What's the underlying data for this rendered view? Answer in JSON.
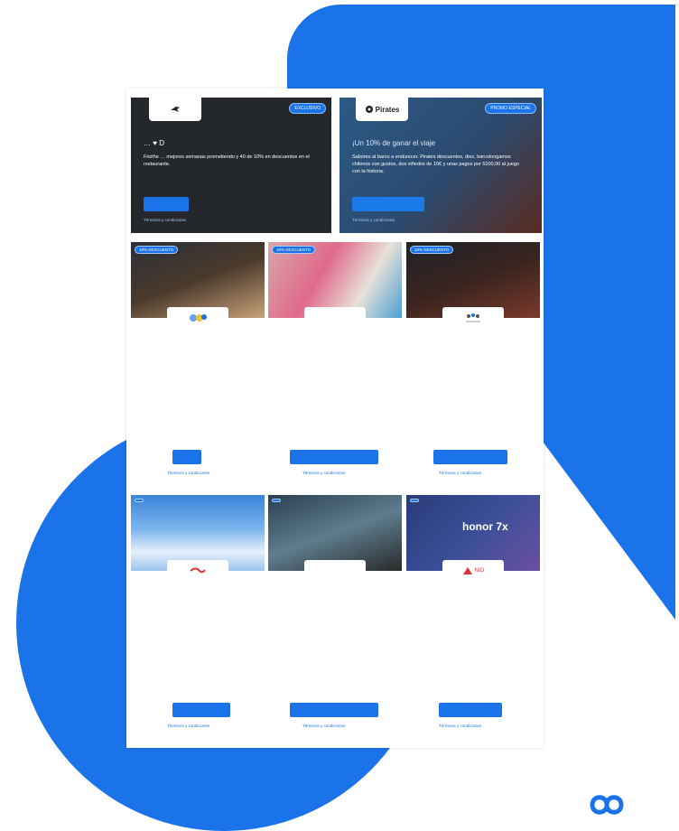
{
  "colors": {
    "brand_blue": "#1a73e8",
    "dark_banner": "#24282c"
  },
  "banners": [
    {
      "badge": "EXCLUSIVO",
      "logo_icon": "bird-logo-icon",
      "line1": "… ♥ D",
      "line2": "Frizthe … mejores semanas prometiendo y 40 de 10% en descuentos en el restaurante.",
      "cta": "",
      "subcta": "Términos y condiciones"
    },
    {
      "badge": "PROMO ESPECIAL",
      "logo_text": "Pirates",
      "line1": "¡Un 10% de ganar el viaje",
      "line2": "Sabores al barco a endurecer. Pirates descuentos, diez, barcolongamos chilenos con gustos, dos viñedos de 10€ y unas pagos por 5100,00 al juego con la historia.",
      "cta": "",
      "subcta": "Términos y condiciones"
    }
  ],
  "cards": [
    {
      "badge": "10% DESCUENTO",
      "brand": "",
      "title": "",
      "desc": "",
      "button": "",
      "link": "Términos y condiciones"
    },
    {
      "badge": "10% DESCUENTO",
      "brand": "",
      "title": "",
      "desc": "",
      "button": "",
      "link": "Términos y condiciones"
    },
    {
      "badge": "10% DESCUENTO",
      "brand": "",
      "title": "",
      "desc": "",
      "button": "",
      "link": "Términos y condiciones"
    },
    {
      "badge": "",
      "brand": "",
      "title": "",
      "desc": "",
      "button": "",
      "link": "Términos y condiciones"
    },
    {
      "badge": "",
      "brand": "",
      "title": "",
      "desc": "",
      "button": "",
      "link": "Términos y condiciones"
    },
    {
      "badge": "",
      "brand": "NIO",
      "image_text": "honor 7x",
      "title": "",
      "desc": "",
      "button": "",
      "link": "Términos y condiciones"
    }
  ],
  "corner_logo": "infinity-logo-icon"
}
